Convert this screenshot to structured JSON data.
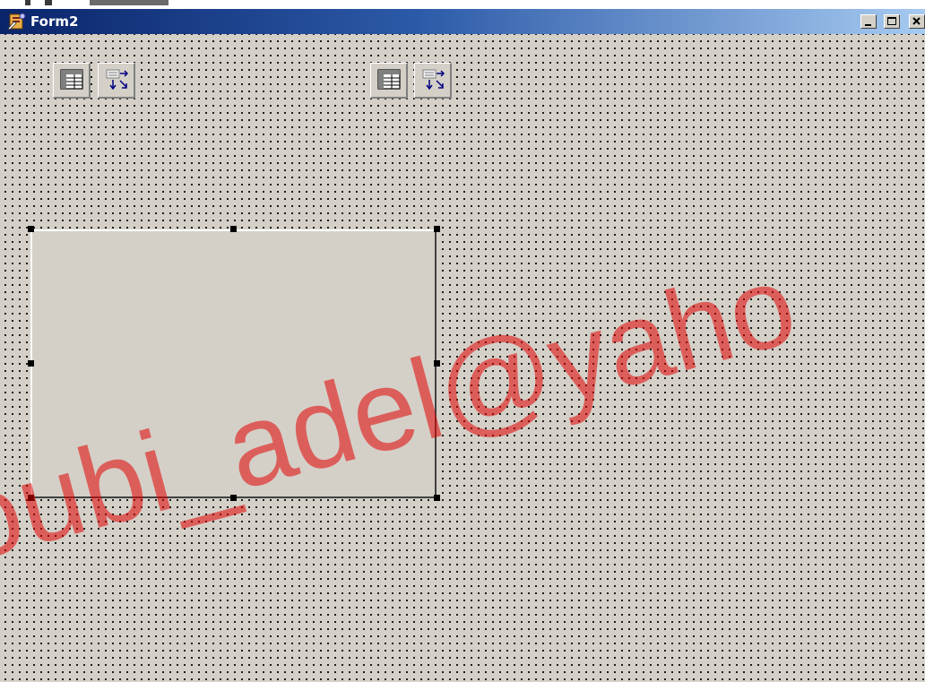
{
  "window": {
    "title": "Form2",
    "icon": "delphi-form-icon"
  },
  "title_buttons": [
    {
      "name": "minimize-button",
      "icon": "minimize-icon"
    },
    {
      "name": "maximize-button",
      "icon": "maximize-icon"
    },
    {
      "name": "close-button",
      "icon": "close-icon"
    }
  ],
  "components": [
    {
      "name": "table-component",
      "icon": "table-icon"
    },
    {
      "name": "datasource-component",
      "icon": "datasource-icon"
    },
    {
      "name": "table-component-2",
      "icon": "table-icon"
    },
    {
      "name": "datasource-component-2",
      "icon": "datasource-icon"
    }
  ],
  "panel": {
    "selected": true
  },
  "watermark": {
    "text": "oubi_adel@yaho"
  },
  "colors": {
    "form_bg": "#d4d0c8",
    "titlebar_start": "#0a246a",
    "titlebar_end": "#a6caf0",
    "watermark": "#e20000"
  }
}
